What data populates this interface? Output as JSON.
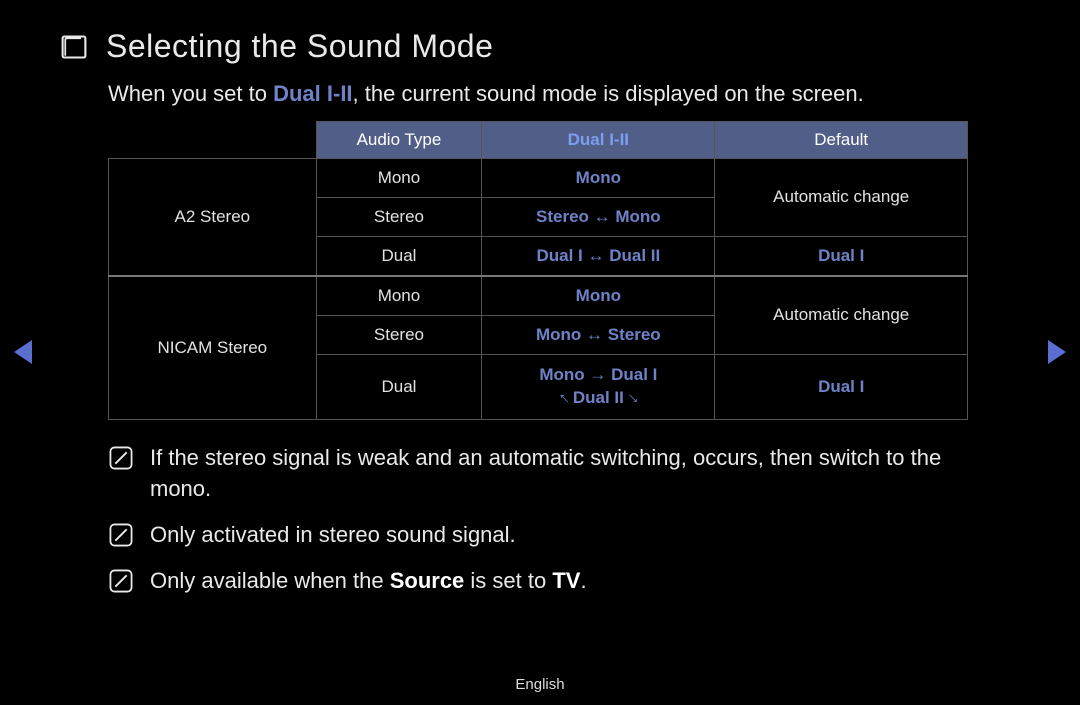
{
  "title": "Selecting the Sound Mode",
  "intro": {
    "pre": "When you set to ",
    "highlight": "Dual I-II",
    "post": ", the current sound mode is displayed on the screen."
  },
  "table": {
    "headers": {
      "audio_type": "Audio Type",
      "dual": "Dual I-II",
      "default": "Default"
    },
    "groups": [
      {
        "name": "A2 Stereo",
        "default_span_text": "Automatic change",
        "rows": [
          {
            "audio": "Mono",
            "dual": "Mono"
          },
          {
            "audio": "Stereo",
            "dual": "Stereo ↔ Mono"
          },
          {
            "audio": "Dual",
            "dual": "Dual I ↔ Dual II",
            "default": "Dual I"
          }
        ]
      },
      {
        "name": "NICAM Stereo",
        "default_span_text": "Automatic change",
        "rows": [
          {
            "audio": "Mono",
            "dual": "Mono"
          },
          {
            "audio": "Stereo",
            "dual": "Mono ↔ Stereo"
          },
          {
            "audio": "Dual",
            "dual_line1": "Mono → Dual I",
            "dual_line2_pre": "↖ ",
            "dual_line2_mid": "Dual II",
            "dual_line2_post": " ↙",
            "default": "Dual I"
          }
        ]
      }
    ]
  },
  "notes": [
    {
      "text": "If the stereo signal is weak and an automatic switching, occurs, then switch to the mono."
    },
    {
      "pre": "Only activated in stereo sound signal."
    },
    {
      "pre": "Only available when the ",
      "b1": "Source",
      "mid": " is set to ",
      "b2": "TV",
      "post": "."
    }
  ],
  "footer": "English"
}
